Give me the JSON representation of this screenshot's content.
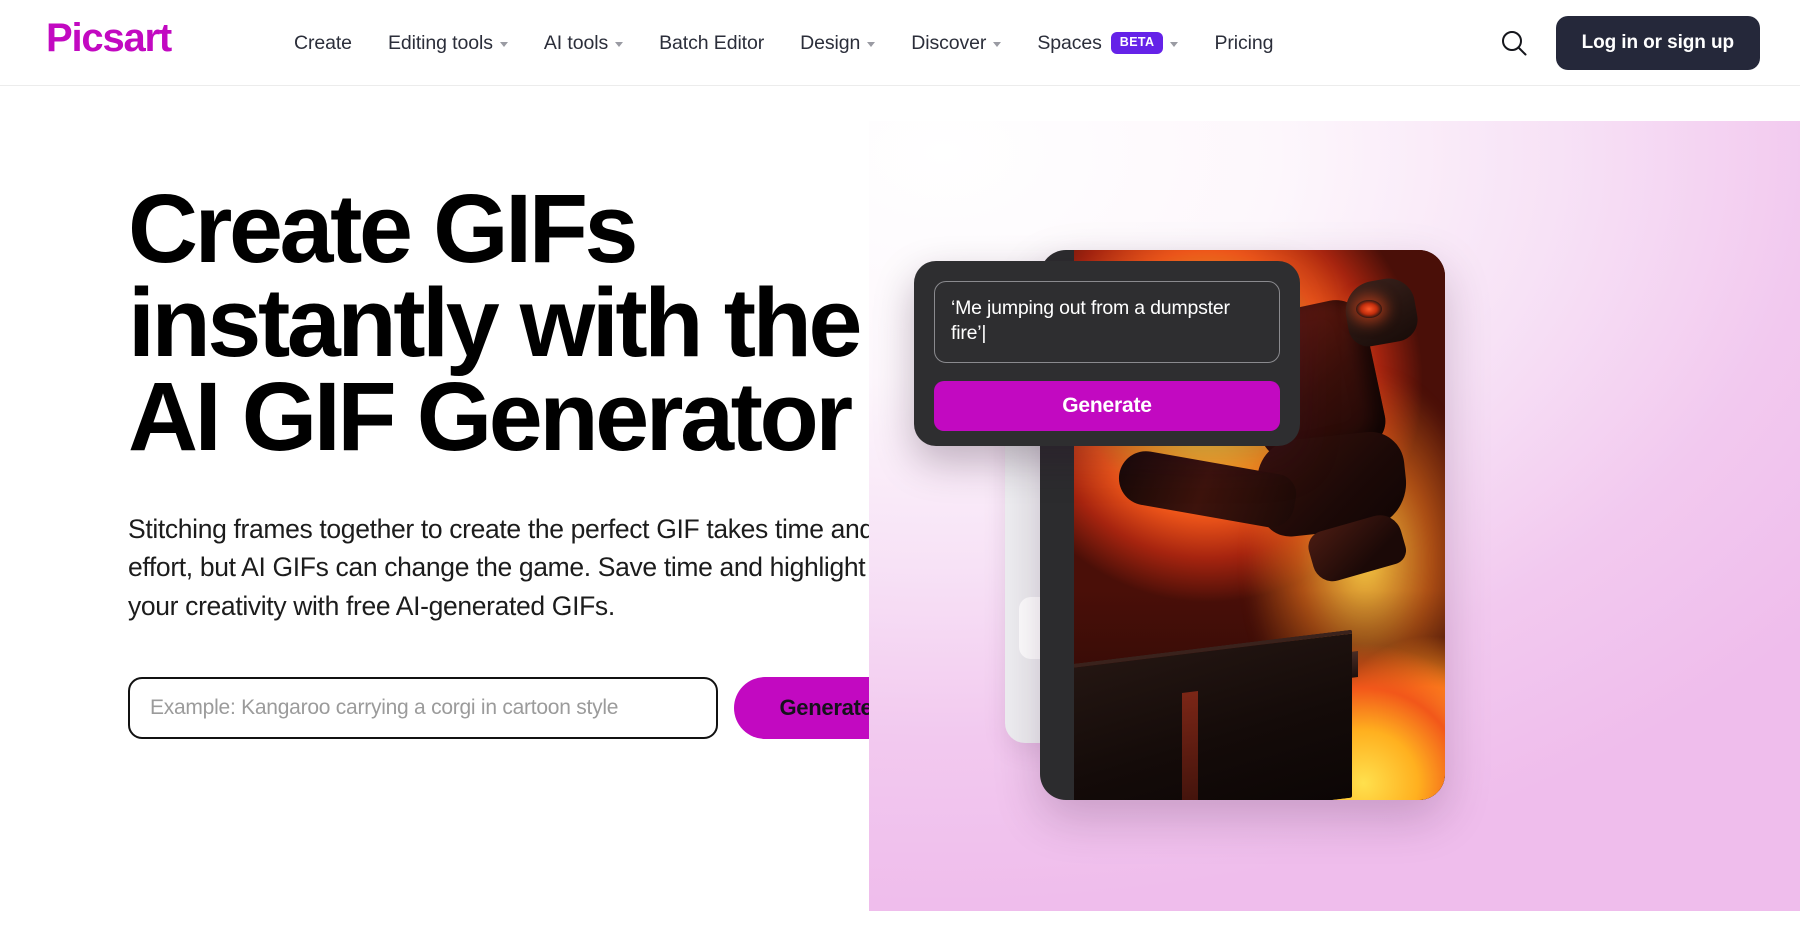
{
  "brand": {
    "logo_text": "Picsart",
    "logo_color": "#C209C1"
  },
  "header": {
    "nav_items": [
      {
        "label": "Create",
        "has_dropdown": false,
        "badge": null
      },
      {
        "label": "Editing tools",
        "has_dropdown": true,
        "badge": null
      },
      {
        "label": "AI tools",
        "has_dropdown": true,
        "badge": null
      },
      {
        "label": "Batch Editor",
        "has_dropdown": false,
        "badge": null
      },
      {
        "label": "Design",
        "has_dropdown": true,
        "badge": null
      },
      {
        "label": "Discover",
        "has_dropdown": true,
        "badge": null
      },
      {
        "label": "Spaces",
        "has_dropdown": true,
        "badge": "BETA"
      },
      {
        "label": "Pricing",
        "has_dropdown": false,
        "badge": null
      }
    ],
    "badge_color": "#6522E8",
    "search_icon": "search-icon",
    "login_label": "Log in or sign up",
    "login_bg": "#25283A"
  },
  "hero": {
    "title": "Create GIFs instantly with the AI GIF Generator",
    "subtitle": "Stitching frames together to create the perfect GIF takes time and effort, but AI GIFs can change the game. Save time and highlight your creativity with free AI-generated GIFs.",
    "prompt_value": "",
    "prompt_placeholder": "Example: Kangaroo carrying a corgi in cartoon style",
    "generate_label": "Generate",
    "generate_color": "#C209C1"
  },
  "preview": {
    "card_prompt_text": "‘Me jumping out from a dumpster fire’|",
    "card_generate_label": "Generate",
    "card_bg": "#2E2E30",
    "panel_gradient_start": "#ffffff",
    "panel_gradient_end": "#efbdec",
    "result_alt": "AI generated GIF of a person leaping out of a burning dumpster"
  }
}
